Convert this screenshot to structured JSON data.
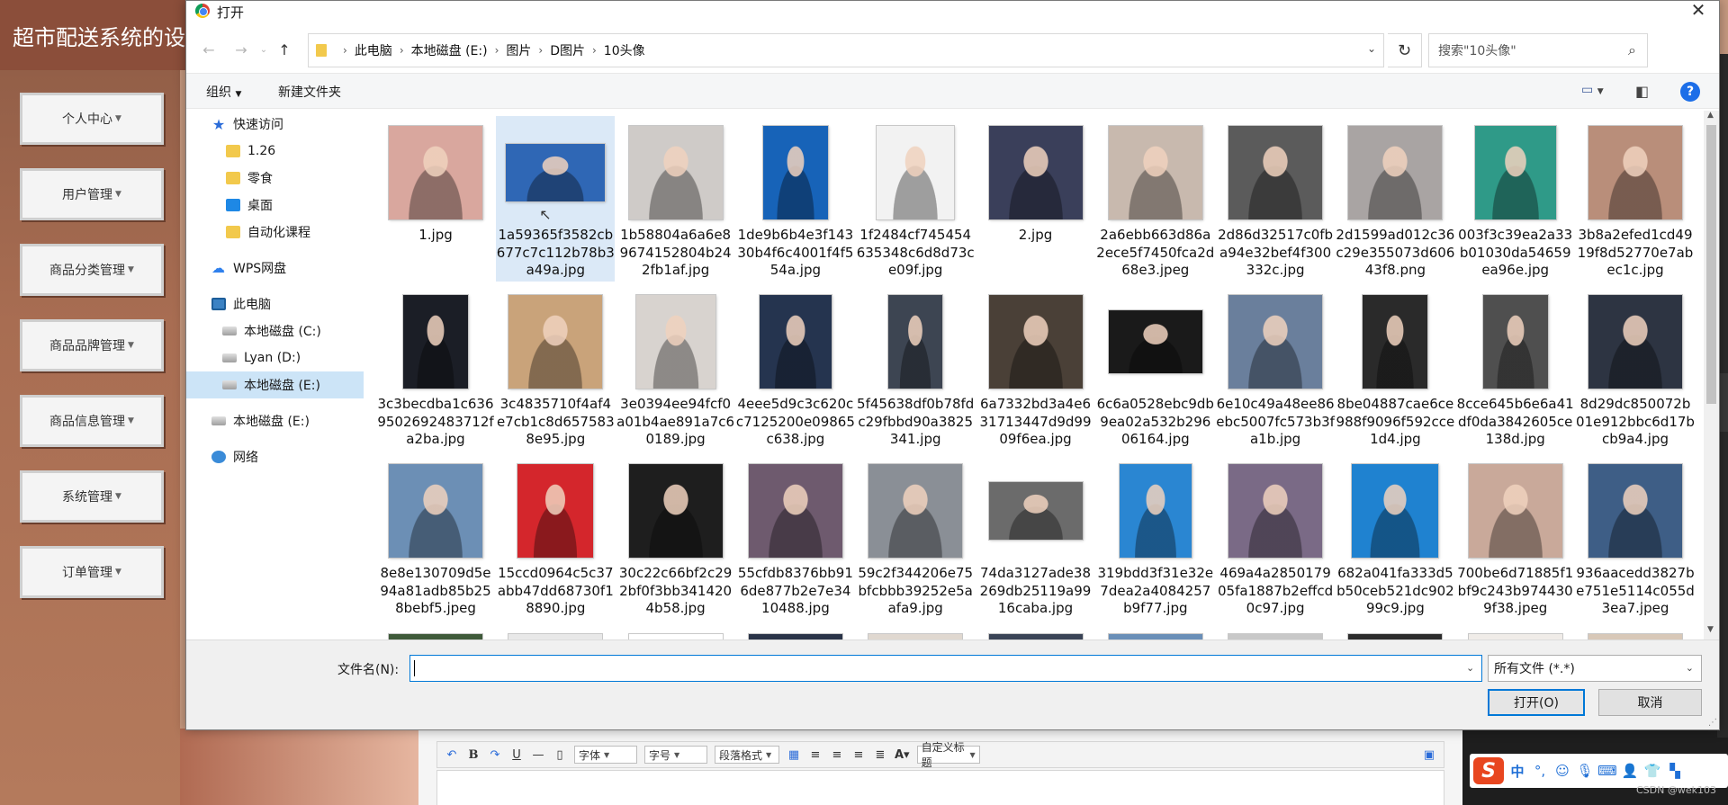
{
  "app": {
    "title": "超市配送系统的设",
    "menu": [
      {
        "label": "个人中心"
      },
      {
        "label": "用户管理"
      },
      {
        "label": "商品分类管理"
      },
      {
        "label": "商品品牌管理"
      },
      {
        "label": "商品信息管理"
      },
      {
        "label": "系统管理"
      },
      {
        "label": "订单管理"
      }
    ],
    "editor": {
      "font_select": "字体",
      "size_select": "字号",
      "paragraph_select": "段落格式",
      "custom_title_select": "自定义标题"
    },
    "watermark": "CSDN @wek103"
  },
  "dialog": {
    "title": "打开",
    "breadcrumb": [
      "此电脑",
      "本地磁盘 (E:)",
      "图片",
      "D图片",
      "10头像"
    ],
    "search_placeholder": "搜索\"10头像\"",
    "toolbar": {
      "organize": "组织",
      "new_folder": "新建文件夹"
    },
    "nav": [
      {
        "label": "快速访问"
      },
      {
        "label": "1.26"
      },
      {
        "label": "零食"
      },
      {
        "label": "桌面"
      },
      {
        "label": "自动化课程"
      },
      {
        "label": "WPS网盘"
      },
      {
        "label": "此电脑"
      },
      {
        "label": "本地磁盘 (C:)"
      },
      {
        "label": "Lyan (D:)"
      },
      {
        "label": "本地磁盘 (E:)"
      },
      {
        "label": "本地磁盘 (E:)"
      },
      {
        "label": "网络"
      }
    ],
    "files": [
      {
        "name": "1.jpg",
        "color": "#d9a79e"
      },
      {
        "name": "1a59365f3582cb677c7c112b78b3a49a.jpg",
        "color": "#2f67b5"
      },
      {
        "name": "1b58804a6a6e89674152804b242fb1af.jpg",
        "color": "#cfcbc8"
      },
      {
        "name": "1de9b6b4e3f14330b4f6c4001f4f554a.jpg",
        "color": "#1763b8"
      },
      {
        "name": "1f2484cf745454635348c6d8d73ce09f.jpg",
        "color": "#f2f2f2"
      },
      {
        "name": "2.jpg",
        "color": "#3a3f5a"
      },
      {
        "name": "2a6ebb663d86a2ece5f7450fca2d68e3.jpeg",
        "color": "#c8b9ae"
      },
      {
        "name": "2d86d32517c0fba94e32bef4f300332c.jpg",
        "color": "#5b5b5b"
      },
      {
        "name": "2d1599ad012c36c29e355073d60643f8.png",
        "color": "#a9a4a3"
      },
      {
        "name": "003f3c39ea2a33b01030da54659ea96e.jpg",
        "color": "#2f9a88"
      },
      {
        "name": "3b8a2efed1cd4919f8d52770e7abec1c.jpg",
        "color": "#b98e7a"
      },
      {
        "name": "3c3becdba1c6369502692483712fa2ba.jpg",
        "color": "#1b1e26"
      },
      {
        "name": "3c4835710f4af4e7cb1c8d6575838e95.jpg",
        "color": "#c9a37a"
      },
      {
        "name": "3e0394ee94fcf0a01b4ae891a7c60189.jpg",
        "color": "#d8d3cf"
      },
      {
        "name": "4eee5d9c3c620cc7125200e09865c638.jpg",
        "color": "#25344f"
      },
      {
        "name": "5f45638df0b78fdc29fbbd90a3825341.jpg",
        "color": "#3d4552"
      },
      {
        "name": "6a7332bd3a4e631713447d9d9909f6ea.jpg",
        "color": "#4a4037"
      },
      {
        "name": "6c6a0528ebc9db9ea02a532b29606164.jpg",
        "color": "#1a1a1a"
      },
      {
        "name": "6e10c49a48ee86ebc5007fc573b3fa1b.jpg",
        "color": "#6a7f9c"
      },
      {
        "name": "8be04887cae6ce988f9096f592cce1d4.jpg",
        "color": "#2a2a2a"
      },
      {
        "name": "8cce645b6e6a41df0da3842605ce138d.jpg",
        "color": "#4f4f4f"
      },
      {
        "name": "8d29dc850072b01e912bbc6d17bcb9a4.jpg",
        "color": "#2d3442"
      },
      {
        "name": "8e8e130709d5e94a81adb85b258bebf5.jpeg",
        "color": "#6c8fb5"
      },
      {
        "name": "15ccd0964c5c37abb47dd68730f18890.jpg",
        "color": "#d4262c"
      },
      {
        "name": "30c22c66bf2c292bf0f3bb3414204b58.jpg",
        "color": "#1e1e1e"
      },
      {
        "name": "55cfdb8376bb916de877b2e7e3410488.jpg",
        "color": "#6e5a6e"
      },
      {
        "name": "59c2f344206e75bfcbbb39252e5aafa9.jpg",
        "color": "#8a8f96"
      },
      {
        "name": "74da3127ade38269db25119a9916caba.jpg",
        "color": "#6b6b6b"
      },
      {
        "name": "319bdd3f31e32e7dea2a4084257b9f77.jpg",
        "color": "#2a86d2"
      },
      {
        "name": "469a4a285017905fa1887b2effcd0c97.jpg",
        "color": "#7a6a86"
      },
      {
        "name": "682a041fa333d5b50ceb521dc90299c9.jpg",
        "color": "#1f82d0"
      },
      {
        "name": "700be6d71885f1bf9c243b9744309f38.jpeg",
        "color": "#c9a99a"
      },
      {
        "name": "936aacedd3827be751e5114c055d3ea7.jpeg",
        "color": "#3e5e86"
      }
    ],
    "file_name_label": "文件名(N):",
    "file_name_value": "",
    "filter": "所有文件 (*.*)",
    "open_button": "打开(O)",
    "cancel_button": "取消"
  }
}
